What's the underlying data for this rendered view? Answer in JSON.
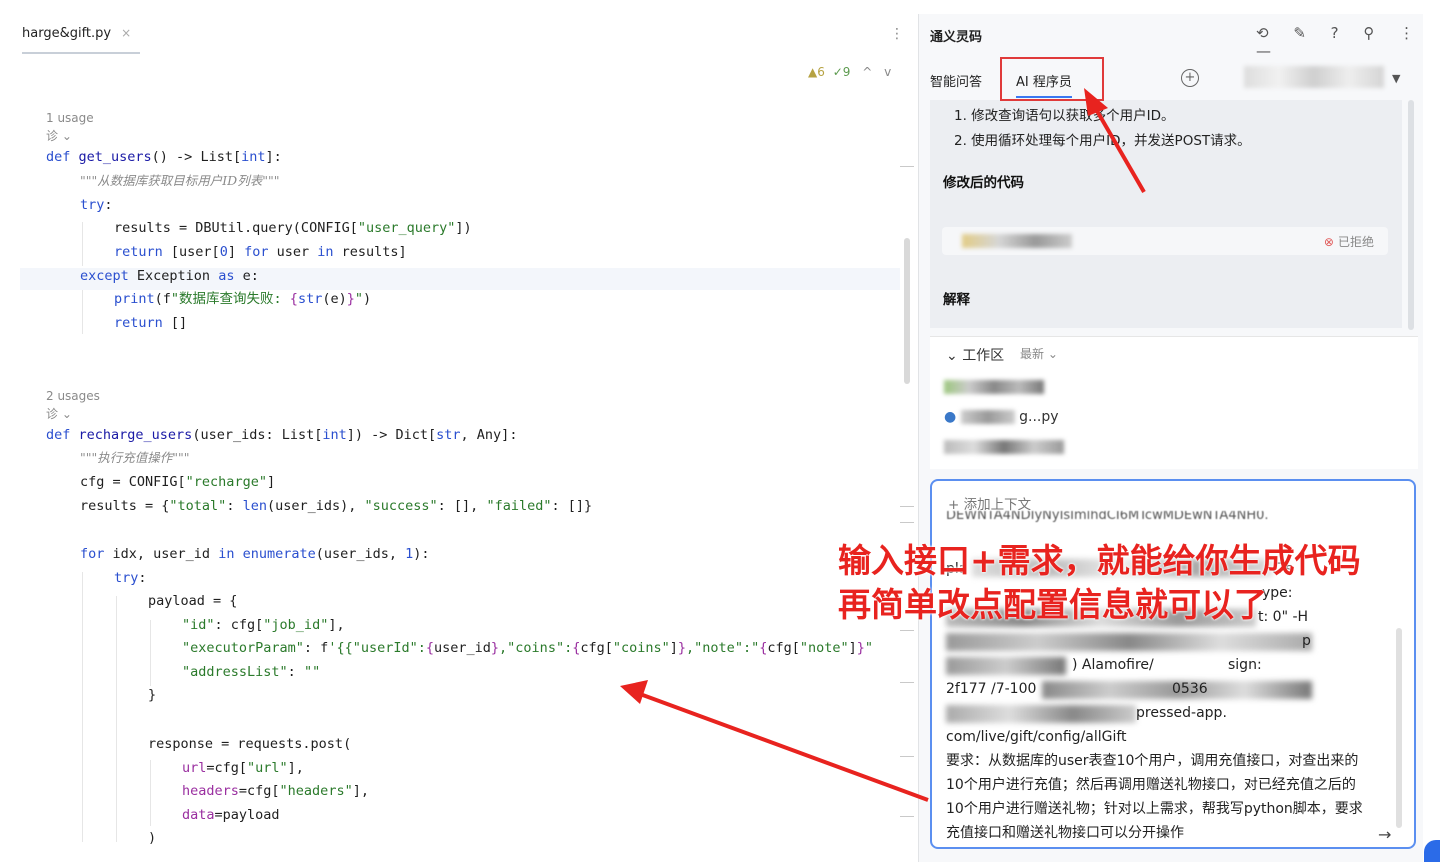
{
  "editor": {
    "tab_title": "harge&gift.py",
    "tab_close": "×",
    "more_icon": "⋮",
    "inspections": {
      "warnings": "▲6",
      "checks": "✓9",
      "up": "^",
      "down": "v"
    },
    "lines": [
      {
        "kind": "meta",
        "text": "1 usage"
      },
      {
        "kind": "meta",
        "text": "诊 ⌄"
      },
      {
        "kind": "code",
        "html": [
          [
            "kw",
            "def "
          ],
          [
            "fn",
            "get_users"
          ],
          [
            "",
            "() -> List["
          ],
          [
            "kw",
            "int"
          ],
          [
            "",
            "]:"
          ]
        ]
      },
      {
        "kind": "code",
        "html": [
          [
            "cm",
            "\"\"\"从数据库获取目标用户ID列表\"\"\""
          ]
        ]
      },
      {
        "kind": "code",
        "html": [
          [
            "kw",
            "try"
          ],
          [
            "",
            ":"
          ]
        ]
      },
      {
        "kind": "code",
        "html": [
          [
            "",
            "results = DBUtil.query(CONFIG["
          ],
          [
            "str",
            "\"user_query\""
          ],
          [
            "",
            "])"
          ]
        ]
      },
      {
        "kind": "code",
        "html": [
          [
            "kw",
            "return "
          ],
          [
            "",
            "[user["
          ],
          [
            "num",
            "0"
          ],
          [
            "",
            "] "
          ],
          [
            "kw",
            "for "
          ],
          [
            "",
            "user "
          ],
          [
            "kw",
            "in "
          ],
          [
            "",
            "results]"
          ]
        ]
      },
      {
        "kind": "code",
        "html": [
          [
            "kw",
            "except "
          ],
          [
            "",
            "Exception "
          ],
          [
            "kw",
            "as "
          ],
          [
            "",
            "e:"
          ]
        ]
      },
      {
        "kind": "code",
        "html": [
          [
            "kw",
            "print"
          ],
          [
            "",
            "(f"
          ],
          [
            "str",
            "\"数据库查询失败: "
          ],
          [
            "par",
            "{"
          ],
          [
            "kw",
            "str"
          ],
          [
            "",
            "(e)"
          ],
          [
            "par",
            "}"
          ],
          [
            "str",
            "\""
          ],
          [
            "",
            ")"
          ]
        ]
      },
      {
        "kind": "code",
        "html": [
          [
            "kw",
            "return "
          ],
          [
            "",
            "[]"
          ]
        ]
      },
      {
        "kind": "meta",
        "text": "2 usages"
      },
      {
        "kind": "meta",
        "text": "诊 ⌄"
      },
      {
        "kind": "code",
        "html": [
          [
            "kw",
            "def "
          ],
          [
            "fn",
            "recharge_users"
          ],
          [
            "",
            "(user_ids: List["
          ],
          [
            "kw",
            "int"
          ],
          [
            "",
            "]) -> Dict["
          ],
          [
            "kw",
            "str"
          ],
          [
            "",
            ", Any]:"
          ]
        ]
      },
      {
        "kind": "code",
        "html": [
          [
            "cm",
            "\"\"\"执行充值操作\"\"\""
          ]
        ]
      },
      {
        "kind": "code",
        "html": [
          [
            "",
            "cfg = CONFIG["
          ],
          [
            "str",
            "\"recharge\""
          ],
          [
            "",
            "]"
          ]
        ]
      },
      {
        "kind": "code",
        "html": [
          [
            "",
            "results = {"
          ],
          [
            "str",
            "\"total\""
          ],
          [
            "",
            ": "
          ],
          [
            "kw",
            "len"
          ],
          [
            "",
            "(user_ids), "
          ],
          [
            "str",
            "\"success\""
          ],
          [
            "",
            ": [], "
          ],
          [
            "str",
            "\"failed\""
          ],
          [
            "",
            ": []}"
          ]
        ]
      },
      {
        "kind": "code",
        "html": [
          [
            "kw",
            "for "
          ],
          [
            "",
            "idx, user_id "
          ],
          [
            "kw",
            "in "
          ],
          [
            "kw",
            "enumerate"
          ],
          [
            "",
            "(user_ids, "
          ],
          [
            "num",
            "1"
          ],
          [
            "",
            "):"
          ]
        ]
      },
      {
        "kind": "code",
        "html": [
          [
            "kw",
            "try"
          ],
          [
            "",
            ":"
          ]
        ]
      },
      {
        "kind": "code",
        "html": [
          [
            "",
            "payload = {"
          ]
        ]
      },
      {
        "kind": "code",
        "html": [
          [
            "str",
            "\"id\""
          ],
          [
            "",
            ": cfg["
          ],
          [
            "str",
            "\"job_id\""
          ],
          [
            "",
            "],"
          ]
        ]
      },
      {
        "kind": "code",
        "html": [
          [
            "str",
            "\"executorParam\""
          ],
          [
            "",
            ": f"
          ],
          [
            "str",
            "'{{\"userId\":"
          ],
          [
            "par",
            "{"
          ],
          [
            "",
            "user_id"
          ],
          [
            "par",
            "}"
          ],
          [
            "str",
            ",\"coins\":"
          ],
          [
            "par",
            "{"
          ],
          [
            "",
            "cfg["
          ],
          [
            "str",
            "\"coins\""
          ],
          [
            "",
            "]"
          ],
          [
            "par",
            "}"
          ],
          [
            "str",
            ",\"note\":\""
          ],
          [
            "par",
            "{"
          ],
          [
            "",
            "cfg["
          ],
          [
            "str",
            "\"note\""
          ],
          [
            "",
            "]"
          ],
          [
            "par",
            "}"
          ],
          [
            "str",
            "\""
          ]
        ]
      },
      {
        "kind": "code",
        "html": [
          [
            "str",
            "\"addressList\""
          ],
          [
            "",
            ": "
          ],
          [
            "str",
            "\"\""
          ]
        ]
      },
      {
        "kind": "code",
        "html": [
          [
            "",
            "}"
          ]
        ]
      },
      {
        "kind": "code",
        "html": [
          [
            "",
            "response = requests.post("
          ]
        ]
      },
      {
        "kind": "code",
        "html": [
          [
            "par",
            "url"
          ],
          [
            "",
            "=cfg["
          ],
          [
            "str",
            "\"url\""
          ],
          [
            "",
            "],"
          ]
        ]
      },
      {
        "kind": "code",
        "html": [
          [
            "par",
            "headers"
          ],
          [
            "",
            "=cfg["
          ],
          [
            "str",
            "\"headers\""
          ],
          [
            "",
            "],"
          ]
        ]
      },
      {
        "kind": "code",
        "html": [
          [
            "par",
            "data"
          ],
          [
            "",
            "=payload"
          ]
        ]
      },
      {
        "kind": "code",
        "html": [
          [
            "",
            ")"
          ]
        ]
      }
    ]
  },
  "panel": {
    "title": "通义灵码",
    "header_icons": [
      "history-icon",
      "edit-icon",
      "help-icon",
      "search-icon",
      "more-icon",
      "minimize-icon"
    ],
    "header_glyphs": "⟲ ✎ ? ⚲ ⋮ —",
    "tab_qa": "智能问答",
    "tab_ai": "AI 程序员",
    "new_chat": "+",
    "user_suffix": "3",
    "msg": {
      "item1": "1. 修改查询语句以获取多个用户ID。",
      "item2": "2. 使用循环处理每个用户ID，并发送POST请求。",
      "modified_heading": "修改后的代码",
      "rejected": "已拒绝",
      "explain_heading": "解释"
    },
    "workspace": {
      "title": "工作区",
      "latest": "最新",
      "file2_suffix": "g...py"
    },
    "input": {
      "add_context": "添加上下文",
      "frag1": "DEWNTA4NDIyNyIsImlhdCI6MTcwMDEwNTA4NH0.",
      "frag2": "pla",
      "frag3": ".7s",
      "frag4": "ype:",
      "frag5": "t: 0\" -H",
      "frag6": "p",
      "frag7": ") Alamofire/",
      "frag8": "sign:",
      "frag9": "2f177 /7-100",
      "frag10": "0536",
      "frag11": "pressed-app.",
      "frag12": "com/live/gift/config/allGift",
      "requirement": "要求：从数据库的user表查10个用户，调用充值接口，对查出来的10个用户进行充值；然后再调用赠送礼物接口，对已经充值之后的10个用户进行赠送礼物；针对以上需求，帮我写python脚本，要求充值接口和赠送礼物接口可以分开操作",
      "send": "→"
    }
  },
  "annotation": {
    "line1": "输入接口+需求，就能给你生成代码",
    "line2": "再简单改点配置信息就可以了",
    "color": "#e8231f"
  },
  "colors": {
    "accent": "#3a78f2",
    "annotation_red": "#e03a3a",
    "keyword": "#2a4fcf",
    "string": "#2b7a2b"
  }
}
